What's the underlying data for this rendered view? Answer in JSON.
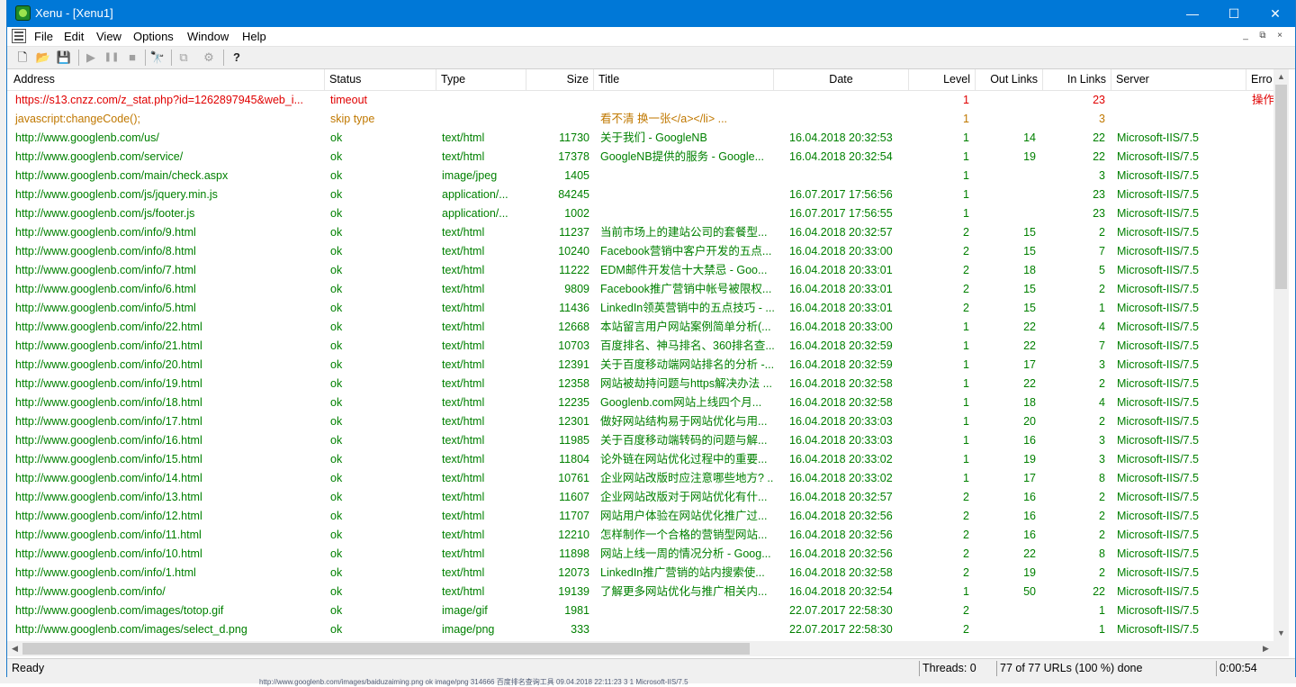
{
  "window": {
    "title": "Xenu - [Xenu1]",
    "minimize": "—",
    "maximize": "☐",
    "close": "✕"
  },
  "menu": [
    "File",
    "Edit",
    "View",
    "Options",
    "Window",
    "Help"
  ],
  "mdi_controls": [
    "_",
    "⧉",
    "×"
  ],
  "toolbar": [
    {
      "name": "new-icon",
      "glyph": "🗋",
      "enabled": true
    },
    {
      "name": "open-icon",
      "glyph": "📂",
      "enabled": true
    },
    {
      "name": "save-icon",
      "glyph": "💾",
      "enabled": true
    },
    {
      "name": "play-icon",
      "glyph": "▶",
      "enabled": false
    },
    {
      "name": "pause-icon",
      "glyph": "❚❚",
      "enabled": false
    },
    {
      "name": "stop-icon",
      "glyph": "■",
      "enabled": false
    },
    {
      "name": "find-icon",
      "glyph": "🔭",
      "enabled": true
    },
    {
      "name": "copy-icon",
      "glyph": "⧉",
      "enabled": false
    },
    {
      "name": "properties-icon",
      "glyph": "⚙",
      "enabled": false
    },
    {
      "name": "help-icon",
      "glyph": "?",
      "enabled": true
    }
  ],
  "columns": [
    "Address",
    "Status",
    "Type",
    "Size",
    "Title",
    "Date",
    "Level",
    "Out Links",
    "In Links",
    "Server",
    "Erro"
  ],
  "colors": {
    "ok": "#008000",
    "error": "#e00000",
    "skipped": "#c07800",
    "titlebar": "#0078d7"
  },
  "rows": [
    {
      "state": "error",
      "address": "https://s13.cnzz.com/z_stat.php?id=1262897945&web_i...",
      "status": "timeout",
      "type": "",
      "size": "",
      "title": "",
      "date": "",
      "level": "1",
      "out": "",
      "in": "23",
      "server": "",
      "error": "操作"
    },
    {
      "state": "skipped",
      "address": "javascript:changeCode();",
      "status": "skip type",
      "type": "",
      "size": "",
      "title": "看不清 换一张</a></li>          ...",
      "date": "",
      "level": "1",
      "out": "",
      "in": "3",
      "server": "",
      "error": ""
    },
    {
      "state": "ok",
      "address": "http://www.googlenb.com/us/",
      "status": "ok",
      "type": "text/html",
      "size": "11730",
      "title": "关于我们 - GoogleNB",
      "date": "16.04.2018  20:32:53",
      "level": "1",
      "out": "14",
      "in": "22",
      "server": "Microsoft-IIS/7.5",
      "error": ""
    },
    {
      "state": "ok",
      "address": "http://www.googlenb.com/service/",
      "status": "ok",
      "type": "text/html",
      "size": "17378",
      "title": "GoogleNB提供的服务 - Google...",
      "date": "16.04.2018  20:32:54",
      "level": "1",
      "out": "19",
      "in": "22",
      "server": "Microsoft-IIS/7.5",
      "error": ""
    },
    {
      "state": "ok",
      "address": "http://www.googlenb.com/main/check.aspx",
      "status": "ok",
      "type": "image/jpeg",
      "size": "1405",
      "title": "",
      "date": "",
      "level": "1",
      "out": "",
      "in": "3",
      "server": "Microsoft-IIS/7.5",
      "error": ""
    },
    {
      "state": "ok",
      "address": "http://www.googlenb.com/js/jquery.min.js",
      "status": "ok",
      "type": "application/...",
      "size": "84245",
      "title": "",
      "date": "16.07.2017  17:56:56",
      "level": "1",
      "out": "",
      "in": "23",
      "server": "Microsoft-IIS/7.5",
      "error": ""
    },
    {
      "state": "ok",
      "address": "http://www.googlenb.com/js/footer.js",
      "status": "ok",
      "type": "application/...",
      "size": "1002",
      "title": "",
      "date": "16.07.2017  17:56:55",
      "level": "1",
      "out": "",
      "in": "23",
      "server": "Microsoft-IIS/7.5",
      "error": ""
    },
    {
      "state": "ok",
      "address": "http://www.googlenb.com/info/9.html",
      "status": "ok",
      "type": "text/html",
      "size": "11237",
      "title": "当前市场上的建站公司的套餐型...",
      "date": "16.04.2018  20:32:57",
      "level": "2",
      "out": "15",
      "in": "2",
      "server": "Microsoft-IIS/7.5",
      "error": ""
    },
    {
      "state": "ok",
      "address": "http://www.googlenb.com/info/8.html",
      "status": "ok",
      "type": "text/html",
      "size": "10240",
      "title": "Facebook营销中客户开发的五点...",
      "date": "16.04.2018  20:33:00",
      "level": "2",
      "out": "15",
      "in": "7",
      "server": "Microsoft-IIS/7.5",
      "error": ""
    },
    {
      "state": "ok",
      "address": "http://www.googlenb.com/info/7.html",
      "status": "ok",
      "type": "text/html",
      "size": "11222",
      "title": "EDM邮件开发信十大禁忌 - Goo...",
      "date": "16.04.2018  20:33:01",
      "level": "2",
      "out": "18",
      "in": "5",
      "server": "Microsoft-IIS/7.5",
      "error": ""
    },
    {
      "state": "ok",
      "address": "http://www.googlenb.com/info/6.html",
      "status": "ok",
      "type": "text/html",
      "size": "9809",
      "title": "Facebook推广营销中帐号被限权...",
      "date": "16.04.2018  20:33:01",
      "level": "2",
      "out": "15",
      "in": "2",
      "server": "Microsoft-IIS/7.5",
      "error": ""
    },
    {
      "state": "ok",
      "address": "http://www.googlenb.com/info/5.html",
      "status": "ok",
      "type": "text/html",
      "size": "11436",
      "title": "LinkedIn领英营销中的五点技巧 - ...",
      "date": "16.04.2018  20:33:01",
      "level": "2",
      "out": "15",
      "in": "1",
      "server": "Microsoft-IIS/7.5",
      "error": ""
    },
    {
      "state": "ok",
      "address": "http://www.googlenb.com/info/22.html",
      "status": "ok",
      "type": "text/html",
      "size": "12668",
      "title": "本站留言用户网站案例简单分析(...",
      "date": "16.04.2018  20:33:00",
      "level": "1",
      "out": "22",
      "in": "4",
      "server": "Microsoft-IIS/7.5",
      "error": ""
    },
    {
      "state": "ok",
      "address": "http://www.googlenb.com/info/21.html",
      "status": "ok",
      "type": "text/html",
      "size": "10703",
      "title": "百度排名、神马排名、360排名查...",
      "date": "16.04.2018  20:32:59",
      "level": "1",
      "out": "22",
      "in": "7",
      "server": "Microsoft-IIS/7.5",
      "error": ""
    },
    {
      "state": "ok",
      "address": "http://www.googlenb.com/info/20.html",
      "status": "ok",
      "type": "text/html",
      "size": "12391",
      "title": "关于百度移动端网站排名的分析 -...",
      "date": "16.04.2018  20:32:59",
      "level": "1",
      "out": "17",
      "in": "3",
      "server": "Microsoft-IIS/7.5",
      "error": ""
    },
    {
      "state": "ok",
      "address": "http://www.googlenb.com/info/19.html",
      "status": "ok",
      "type": "text/html",
      "size": "12358",
      "title": "网站被劫持问题与https解决办法 ...",
      "date": "16.04.2018  20:32:58",
      "level": "1",
      "out": "22",
      "in": "2",
      "server": "Microsoft-IIS/7.5",
      "error": ""
    },
    {
      "state": "ok",
      "address": "http://www.googlenb.com/info/18.html",
      "status": "ok",
      "type": "text/html",
      "size": "12235",
      "title": "Googlenb.com网站上线四个月...",
      "date": "16.04.2018  20:32:58",
      "level": "1",
      "out": "18",
      "in": "4",
      "server": "Microsoft-IIS/7.5",
      "error": ""
    },
    {
      "state": "ok",
      "address": "http://www.googlenb.com/info/17.html",
      "status": "ok",
      "type": "text/html",
      "size": "12301",
      "title": "做好网站结构易于网站优化与用...",
      "date": "16.04.2018  20:33:03",
      "level": "1",
      "out": "20",
      "in": "2",
      "server": "Microsoft-IIS/7.5",
      "error": ""
    },
    {
      "state": "ok",
      "address": "http://www.googlenb.com/info/16.html",
      "status": "ok",
      "type": "text/html",
      "size": "11985",
      "title": "关于百度移动端转码的问题与解...",
      "date": "16.04.2018  20:33:03",
      "level": "1",
      "out": "16",
      "in": "3",
      "server": "Microsoft-IIS/7.5",
      "error": ""
    },
    {
      "state": "ok",
      "address": "http://www.googlenb.com/info/15.html",
      "status": "ok",
      "type": "text/html",
      "size": "11804",
      "title": "论外链在网站优化过程中的重要...",
      "date": "16.04.2018  20:33:02",
      "level": "1",
      "out": "19",
      "in": "3",
      "server": "Microsoft-IIS/7.5",
      "error": ""
    },
    {
      "state": "ok",
      "address": "http://www.googlenb.com/info/14.html",
      "status": "ok",
      "type": "text/html",
      "size": "10761",
      "title": "企业网站改版时应注意哪些地方? ...",
      "date": "16.04.2018  20:33:02",
      "level": "1",
      "out": "17",
      "in": "8",
      "server": "Microsoft-IIS/7.5",
      "error": ""
    },
    {
      "state": "ok",
      "address": "http://www.googlenb.com/info/13.html",
      "status": "ok",
      "type": "text/html",
      "size": "11607",
      "title": "企业网站改版对于网站优化有什...",
      "date": "16.04.2018  20:32:57",
      "level": "2",
      "out": "16",
      "in": "2",
      "server": "Microsoft-IIS/7.5",
      "error": ""
    },
    {
      "state": "ok",
      "address": "http://www.googlenb.com/info/12.html",
      "status": "ok",
      "type": "text/html",
      "size": "11707",
      "title": "网站用户体验在网站优化推广过...",
      "date": "16.04.2018  20:32:56",
      "level": "2",
      "out": "16",
      "in": "2",
      "server": "Microsoft-IIS/7.5",
      "error": ""
    },
    {
      "state": "ok",
      "address": "http://www.googlenb.com/info/11.html",
      "status": "ok",
      "type": "text/html",
      "size": "12210",
      "title": "怎样制作一个合格的营销型网站...",
      "date": "16.04.2018  20:32:56",
      "level": "2",
      "out": "16",
      "in": "2",
      "server": "Microsoft-IIS/7.5",
      "error": ""
    },
    {
      "state": "ok",
      "address": "http://www.googlenb.com/info/10.html",
      "status": "ok",
      "type": "text/html",
      "size": "11898",
      "title": "网站上线一周的情况分析 - Goog...",
      "date": "16.04.2018  20:32:56",
      "level": "2",
      "out": "22",
      "in": "8",
      "server": "Microsoft-IIS/7.5",
      "error": ""
    },
    {
      "state": "ok",
      "address": "http://www.googlenb.com/info/1.html",
      "status": "ok",
      "type": "text/html",
      "size": "12073",
      "title": "LinkedIn推广营销的站内搜索使...",
      "date": "16.04.2018  20:32:58",
      "level": "2",
      "out": "19",
      "in": "2",
      "server": "Microsoft-IIS/7.5",
      "error": ""
    },
    {
      "state": "ok",
      "address": "http://www.googlenb.com/info/",
      "status": "ok",
      "type": "text/html",
      "size": "19139",
      "title": "了解更多网站优化与推广相关内...",
      "date": "16.04.2018  20:32:54",
      "level": "1",
      "out": "50",
      "in": "22",
      "server": "Microsoft-IIS/7.5",
      "error": ""
    },
    {
      "state": "ok",
      "address": "http://www.googlenb.com/images/totop.gif",
      "status": "ok",
      "type": "image/gif",
      "size": "1981",
      "title": "",
      "date": "22.07.2017  22:58:30",
      "level": "2",
      "out": "",
      "in": "1",
      "server": "Microsoft-IIS/7.5",
      "error": ""
    },
    {
      "state": "ok",
      "address": "http://www.googlenb.com/images/select_d.png",
      "status": "ok",
      "type": "image/png",
      "size": "333",
      "title": "",
      "date": "22.07.2017  22:58:30",
      "level": "2",
      "out": "",
      "in": "1",
      "server": "Microsoft-IIS/7.5",
      "error": ""
    }
  ],
  "status": {
    "ready": "Ready",
    "threads": "Threads: 0",
    "progress": "77 of 77 URLs (100 %) done",
    "elapsed": "0:00:54"
  },
  "background_row": "http://www.googlenb.com/images/baiduzaiming.png        ok              image/png        314666    百度排名查询工具                              09.04.2018  22:11:23          3                    1     Microsoft-IIS/7.5"
}
